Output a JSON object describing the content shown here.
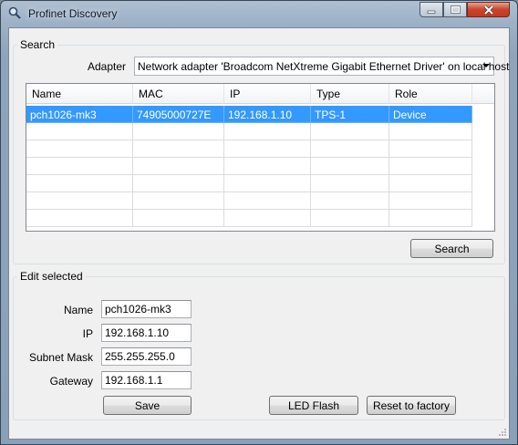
{
  "window": {
    "title": "Profinet Discovery"
  },
  "search": {
    "group_label": "Search",
    "adapter_label": "Adapter",
    "adapter_value": "Network adapter 'Broadcom NetXtreme Gigabit Ethernet Driver' on local host",
    "columns": [
      "Name",
      "MAC",
      "IP",
      "Type",
      "Role"
    ],
    "rows": [
      {
        "name": "pch1026-mk3",
        "mac": "74905000727E",
        "ip": "192.168.1.10",
        "type": "TPS-1",
        "role": "Device",
        "selected": true
      }
    ],
    "search_button": "Search"
  },
  "edit": {
    "group_label": "Edit selected",
    "name_label": "Name",
    "name_value": "pch1026-mk3",
    "ip_label": "IP",
    "ip_value": "192.168.1.10",
    "subnet_label": "Subnet Mask",
    "subnet_value": "255.255.255.0",
    "gateway_label": "Gateway",
    "gateway_value": "192.168.1.1",
    "save_button": "Save",
    "led_button": "LED Flash",
    "reset_button": "Reset to factory"
  }
}
